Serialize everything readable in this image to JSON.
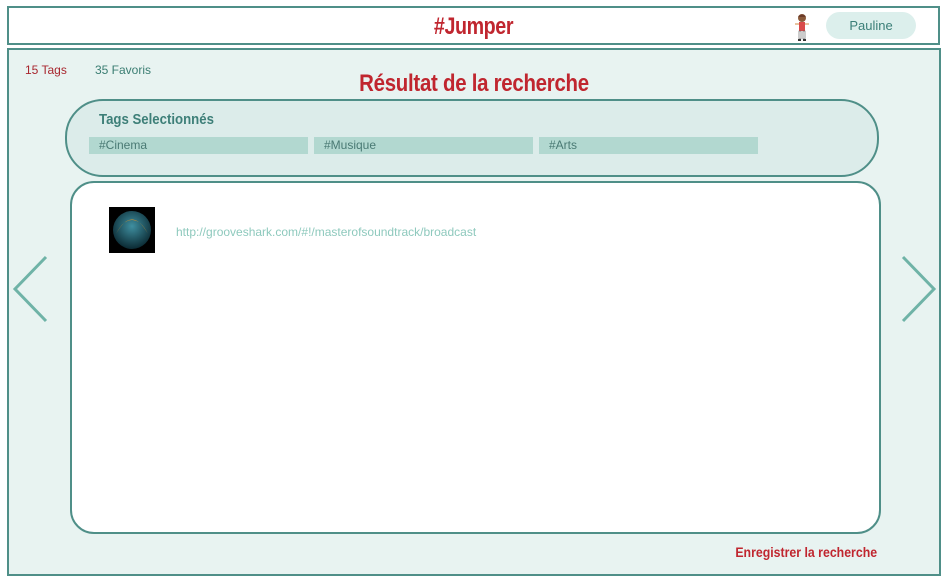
{
  "header": {
    "app_title": "#Jumper",
    "user_name": "Pauline"
  },
  "main": {
    "tag_count": "15 Tags",
    "favorites_count": "35 Favoris",
    "results_title": "Résultat de la recherche",
    "selected_tags_heading": "Tags Selectionnés",
    "selected_tags": [
      "#Cinema",
      "#Musique",
      "#Arts"
    ],
    "results": [
      {
        "url": "http://grooveshark.com/#!/masterofsoundtrack/broadcast",
        "icon": "grooveshark-icon"
      }
    ],
    "save_search_label": "Enregistrer la recherche"
  },
  "colors": {
    "accent_red": "#c0262f",
    "teal_border": "#4f8f88",
    "panel_bg": "#e8f3f1",
    "chip_bg": "#b2d8d0",
    "link": "#8ec9bd"
  },
  "icons": {
    "avatar": "avatar-icon",
    "prev": "chevron-left-icon",
    "next": "chevron-right-icon"
  }
}
